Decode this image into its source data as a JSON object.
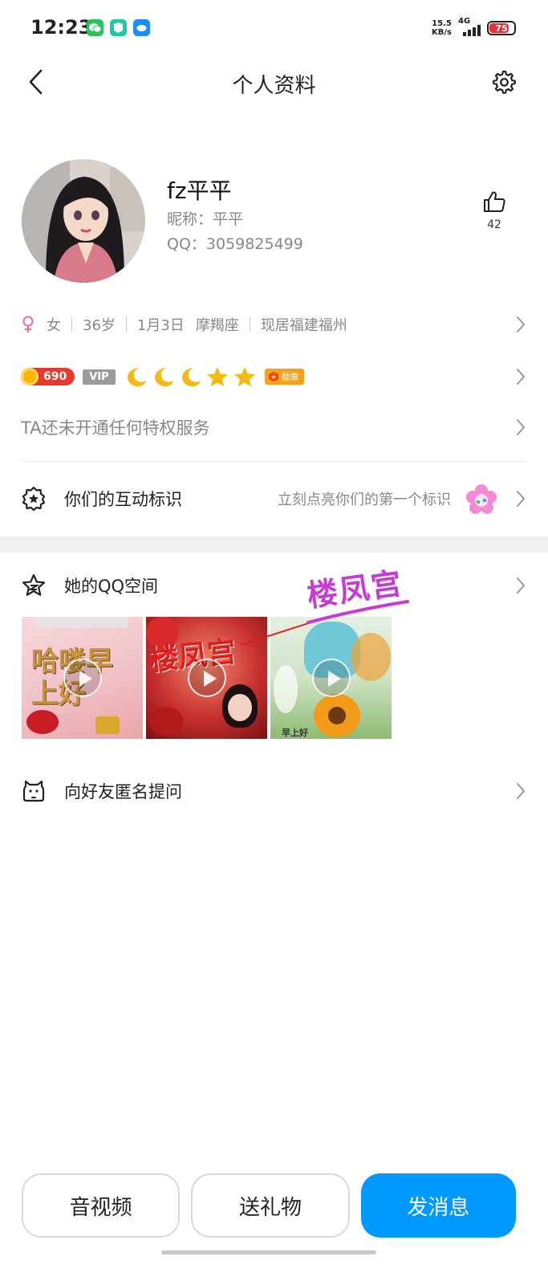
{
  "status_bar": {
    "time": "12:23",
    "net_speed_value": "15.5",
    "net_speed_unit": "KB/s",
    "network": "4G",
    "battery": "75",
    "app_icons": [
      "wechat-icon",
      "green-app-icon",
      "cloud-app-icon"
    ]
  },
  "header": {
    "title": "个人资料",
    "back_icon": "chevron-left-icon",
    "settings_icon": "gear-icon"
  },
  "profile": {
    "name": "fz平平",
    "nickname": "昵称：平平",
    "qq": "QQ：3059825499",
    "like_count": "42"
  },
  "info": {
    "gender": "女",
    "age": "36岁",
    "birthday": "1月3日",
    "zodiac": "摩羯座",
    "location": "现居福建福州"
  },
  "badges": {
    "level": "690",
    "vip": "VIP",
    "honor": "勋章"
  },
  "privilege": {
    "text": "TA还未开通任何特权服务"
  },
  "interaction": {
    "label": "你们的互动标识",
    "hint": "立刻点亮你们的第一个标识"
  },
  "qzone": {
    "label": "她的QQ空间",
    "thumbs": [
      {
        "text": "哈喽早上好"
      },
      {
        "text": "楼凤宫"
      },
      {
        "text": "早上好"
      }
    ],
    "watermark": "楼凤宫"
  },
  "ask": {
    "label": "向好友匿名提问"
  },
  "bottom_bar": {
    "av": "音视频",
    "gift": "送礼物",
    "message": "发消息"
  },
  "colors": {
    "accent": "#0099ff",
    "gender": "#f06ca0",
    "level": "#e83a2c"
  }
}
